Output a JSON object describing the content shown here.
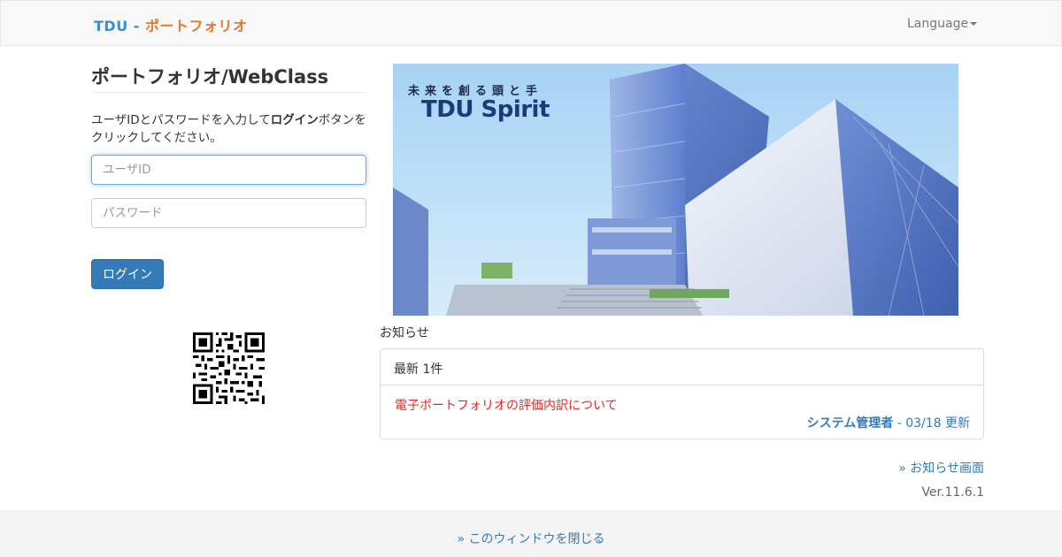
{
  "navbar": {
    "brand_prefix": "TDU -",
    "brand_suffix": "ポートフォリオ",
    "language_label": "Language"
  },
  "login": {
    "title": "ポートフォリオ/WebClass",
    "instructions_before": "ユーザIDとパスワードを入力して",
    "instructions_bold": "ログイン",
    "instructions_after": "ボタンをクリックしてください。",
    "userid_placeholder": "ユーザID",
    "password_placeholder": "パスワード",
    "login_button": "ログイン"
  },
  "banner": {
    "tagline": "未来を創る頭と手",
    "logo_text": "TDU Spirit"
  },
  "news": {
    "section_label": "お知らせ",
    "panel_heading": "最新 1件",
    "items": [
      {
        "title": "電子ポートフォリオの評価内訳について",
        "author": "システム管理者",
        "meta_suffix": " - 03/18 更新"
      }
    ],
    "more_link": "» お知らせ画面"
  },
  "version": "Ver.11.6.1",
  "footer": {
    "close_link": "» このウィンドウを閉じる"
  },
  "colors": {
    "primary": "#337ab7",
    "brand_blue": "#3a8fc8",
    "brand_orange": "#e8762b",
    "news_red": "#e8251f"
  }
}
